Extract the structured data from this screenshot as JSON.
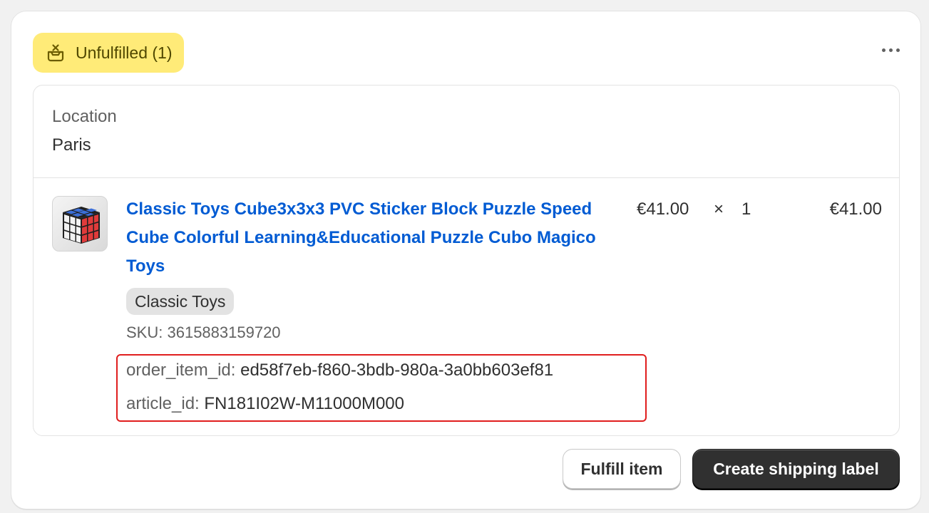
{
  "status_badge": {
    "label": "Unfulfilled (1)",
    "icon": "package-unfulfilled-icon",
    "color": "#ffeb78"
  },
  "more_actions_icon": "ellipsis-icon",
  "location": {
    "label": "Location",
    "value": "Paris"
  },
  "line_item": {
    "title": "Classic Toys Cube3x3x3 PVC Sticker Block Puzzle Speed Cube Colorful Learning&Educational Puzzle Cubo Magico Toys",
    "vendor": "Classic Toys",
    "sku_label": "SKU:",
    "sku_value": "3615883159720",
    "unit_price": "€41.00",
    "times": "×",
    "quantity": "1",
    "total": "€41.00",
    "properties": [
      {
        "key": "order_item_id:",
        "value": "ed58f7eb-f860-3bdb-980a-3a0bb603ef81"
      },
      {
        "key": "article_id:",
        "value": "FN181I02W-M11000M000"
      }
    ]
  },
  "actions": {
    "fulfill_label": "Fulfill item",
    "shipping_label": "Create shipping label"
  },
  "colors": {
    "link": "#005bd3",
    "highlight_border": "#e01e1e",
    "primary_button": "#303030"
  }
}
